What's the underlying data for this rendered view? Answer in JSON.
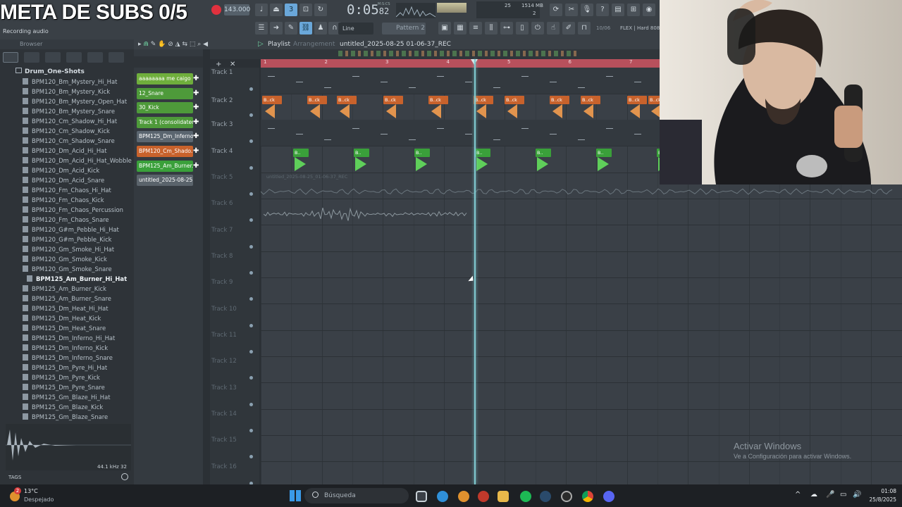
{
  "overlay": {
    "stream_title": "META DE SUBS 0/5"
  },
  "toolbar": {
    "tempo": "143.000",
    "time": "0:05",
    "time_frac": "82",
    "time_sub": "M:S:CS",
    "cpu_num": "25",
    "memory": "1514 MB",
    "polyphony": "2",
    "recording_label": "Recording audio",
    "snap": "Line",
    "pattern": "Pattern 2",
    "flex_info": "10/06",
    "hint": "FLEX | Hard 808s"
  },
  "browser": {
    "title": "Browser",
    "folder": "Drum_One-Shots",
    "files": [
      "BPM120_Bm_Mystery_Hi_Hat",
      "BPM120_Bm_Mystery_Kick",
      "BPM120_Bm_Mystery_Open_Hat",
      "BPM120_Bm_Mystery_Snare",
      "BPM120_Cm_Shadow_Hi_Hat",
      "BPM120_Cm_Shadow_Kick",
      "BPM120_Cm_Shadow_Snare",
      "BPM120_Dm_Acid_Hi_Hat",
      "BPM120_Dm_Acid_Hi_Hat_Wobble",
      "BPM120_Dm_Acid_Kick",
      "BPM120_Dm_Acid_Snare",
      "BPM120_Fm_Chaos_Hi_Hat",
      "BPM120_Fm_Chaos_Kick",
      "BPM120_Fm_Chaos_Percussion",
      "BPM120_Fm_Chaos_Snare",
      "BPM120_G#m_Pebble_Hi_Hat",
      "BPM120_G#m_Pebble_Kick",
      "BPM120_Gm_Smoke_Hi_Hat",
      "BPM120_Gm_Smoke_Kick",
      "BPM120_Gm_Smoke_Snare",
      "BPM125_Am_Burner_Hi_Hat",
      "BPM125_Am_Burner_Kick",
      "BPM125_Am_Burner_Snare",
      "BPM125_Dm_Heat_Hi_Hat",
      "BPM125_Dm_Heat_Kick",
      "BPM125_Dm_Heat_Snare",
      "BPM125_Dm_Inferno_Hi_Hat",
      "BPM125_Dm_Inferno_Kick",
      "BPM125_Dm_Inferno_Snare",
      "BPM125_Dm_Pyre_Hi_Hat",
      "BPM125_Dm_Pyre_Kick",
      "BPM125_Dm_Pyre_Snare",
      "BPM125_Gm_Blaze_Hi_Hat",
      "BPM125_Gm_Blaze_Kick",
      "BPM125_Gm_Blaze_Snare"
    ],
    "selected_index": 20,
    "preview_info": "44.1 kHz 32",
    "tags_label": "TAGS"
  },
  "channels": [
    {
      "name": "aaaaaaaa me caigo",
      "color": "#6fae3c"
    },
    {
      "name": "12_Snare",
      "color": "#4e9a3a"
    },
    {
      "name": "30_Kick",
      "color": "#4e9a3a"
    },
    {
      "name": "Track 1 (consolidated)",
      "color": "#4e9a3a"
    },
    {
      "name": "BPM125_Dm_Inferno...",
      "color": "#5b6670"
    },
    {
      "name": "BPM120_Cm_Shado...",
      "color": "#c8622c"
    },
    {
      "name": "BPM125_Am_Burner...",
      "color": "#3aa03a"
    },
    {
      "name": "untitled_2025-08-25 01-...",
      "color": "#5a636b"
    }
  ],
  "playlist": {
    "title": "Playlist",
    "subtitle": "Arrangement",
    "file": "untitled_2025-08-25 01-06-37_REC",
    "bars": [
      "1",
      "2",
      "3",
      "4",
      "5",
      "6",
      "7"
    ],
    "tracks": [
      "Track 1",
      "Track 2",
      "Track 3",
      "Track 4",
      "Track 5",
      "Track 6",
      "Track 7",
      "Track 8",
      "Track 9",
      "Track 10",
      "Track 11",
      "Track 12",
      "Track 13",
      "Track 14",
      "Track 15",
      "Track 16"
    ],
    "pattern_labels": [
      "Pattern 2",
      "Pattern 2",
      "Pattern 3",
      "Pattern 3"
    ],
    "clip_label_orange": "B..ck",
    "clip_label_green": "B..",
    "audio_clip_label": "untitled_2025-08-25_01-06-37_REC"
  },
  "watermark": {
    "title": "Activar Windows",
    "subtitle": "Ve a Configuración para activar Windows."
  },
  "taskbar": {
    "temp": "13°C",
    "weather": "Despejado",
    "notifications": "2",
    "search_placeholder": "Búsqueda",
    "time": "01:08",
    "date": "25/8/2025"
  }
}
